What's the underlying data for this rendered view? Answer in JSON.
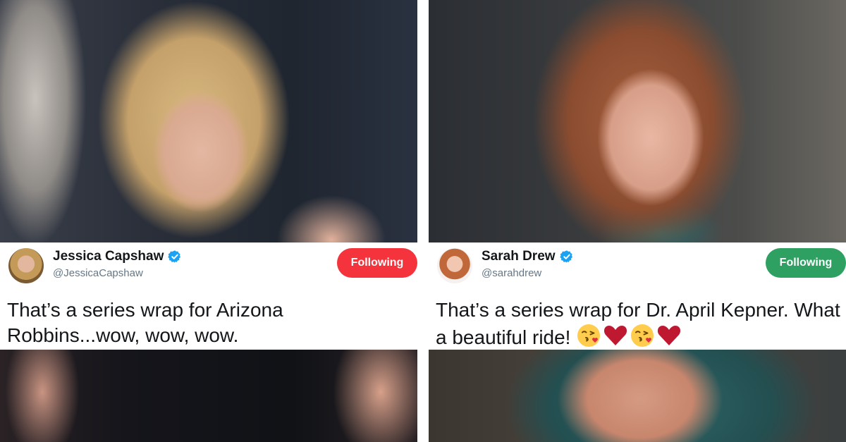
{
  "tweets": [
    {
      "display_name": "Jessica Capshaw",
      "handle": "@JessicaCapshaw",
      "verified": true,
      "follow_button_label": "Following",
      "follow_button_color": "#f4333c",
      "text": "That’s a series wrap for Arizona Robbins...wow, wow, wow.",
      "emojis": []
    },
    {
      "display_name": "Sarah Drew",
      "handle": "@sarahdrew",
      "verified": true,
      "follow_button_label": "Following",
      "follow_button_color": "#2ea061",
      "text": "That’s a series wrap for Dr. April Kepner. What a beautiful ride!",
      "emojis": [
        "face-blowing-kiss",
        "red-heart",
        "face-blowing-kiss",
        "red-heart"
      ]
    }
  ],
  "colors": {
    "verified_badge": "#1da1f2",
    "text_primary": "#14171a",
    "text_secondary": "#657786"
  }
}
